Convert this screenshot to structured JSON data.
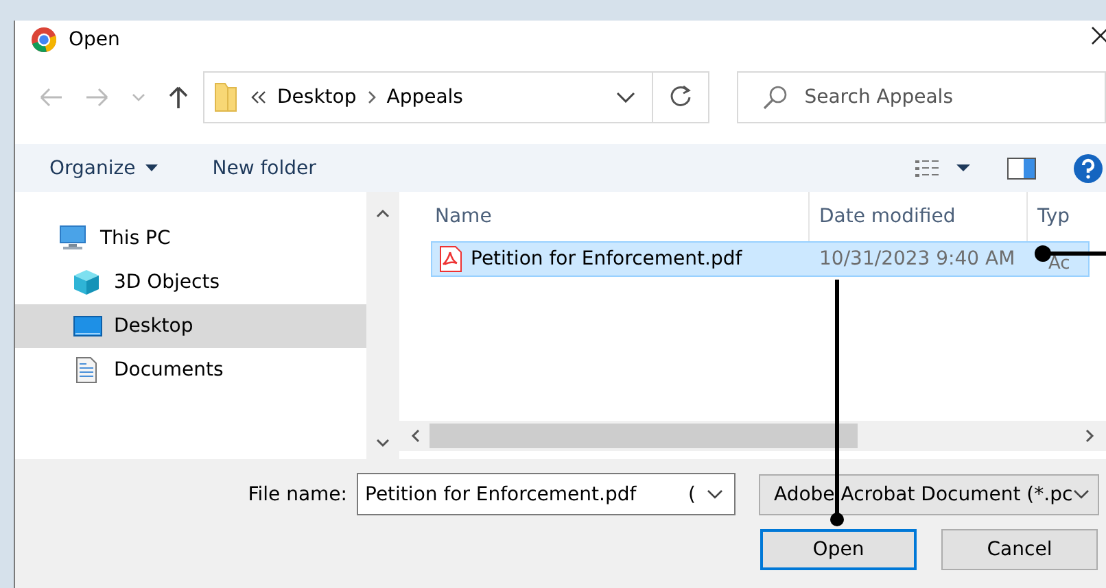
{
  "window": {
    "title": "Open"
  },
  "address": {
    "breadcrumb": [
      "Desktop",
      "Appeals"
    ]
  },
  "search": {
    "placeholder": "Search Appeals"
  },
  "toolbar": {
    "organize": "Organize",
    "new_folder": "New folder"
  },
  "sidebar": {
    "items": [
      {
        "label": "This PC",
        "kind": "pc",
        "selected": false,
        "children": [
          {
            "label": "3D Objects",
            "kind": "cube",
            "selected": false
          },
          {
            "label": "Desktop",
            "kind": "desktop",
            "selected": true
          },
          {
            "label": "Documents",
            "kind": "documents",
            "selected": false
          }
        ]
      }
    ]
  },
  "file_list": {
    "columns": [
      "Name",
      "Date modified",
      "Typ"
    ],
    "rows": [
      {
        "name": "Petition for Enforcement.pdf",
        "date": "10/31/2023 9:40 AM",
        "type": "Ac",
        "selected": true
      }
    ]
  },
  "footer": {
    "file_name_label": "File name:",
    "file_name": "Petition for Enforcement.pdf",
    "file_name_overflow": "(",
    "file_type": "Adobe Acrobat Document (*.pc",
    "buttons": [
      {
        "label": "Open",
        "default": true
      },
      {
        "label": "Cancel",
        "default": false
      }
    ]
  }
}
